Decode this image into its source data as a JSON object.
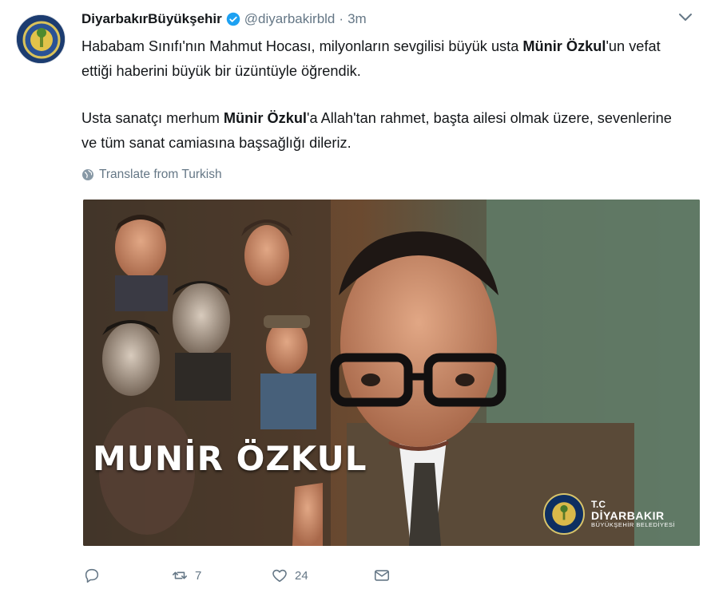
{
  "tweet": {
    "display_name": "DiyarbakırBüyükşehir",
    "handle": "@diyarbakirbld",
    "separator": "·",
    "time": "3m",
    "paragraph1": {
      "pre": "Hababam Sınıfı'nın Mahmut Hocası, milyonların sevgilisi büyük usta ",
      "bold": "Münir Özkul",
      "post": "'un vefat ettiği haberini büyük bir üzüntüyle öğrendik."
    },
    "paragraph2": {
      "pre": "Usta sanatçı merhum ",
      "bold": "Münir Özkul",
      "post": "'a Allah'tan rahmet, başta ailesi olmak üzere, sevenlerine ve tüm sanat camiasına başsağlığı dileriz."
    },
    "translate_label": "Translate from Turkish",
    "media": {
      "title": "MUNİR ÖZKUL",
      "brand_line1": "T.C",
      "brand_line2": "DİYARBAKIR",
      "brand_line3": "BÜYÜKŞEHİR BELEDİYESİ"
    },
    "actions": {
      "retweets": "7",
      "likes": "24"
    },
    "colors": {
      "verified": "#1da1f2",
      "muted": "#657786",
      "text": "#14171a"
    }
  }
}
